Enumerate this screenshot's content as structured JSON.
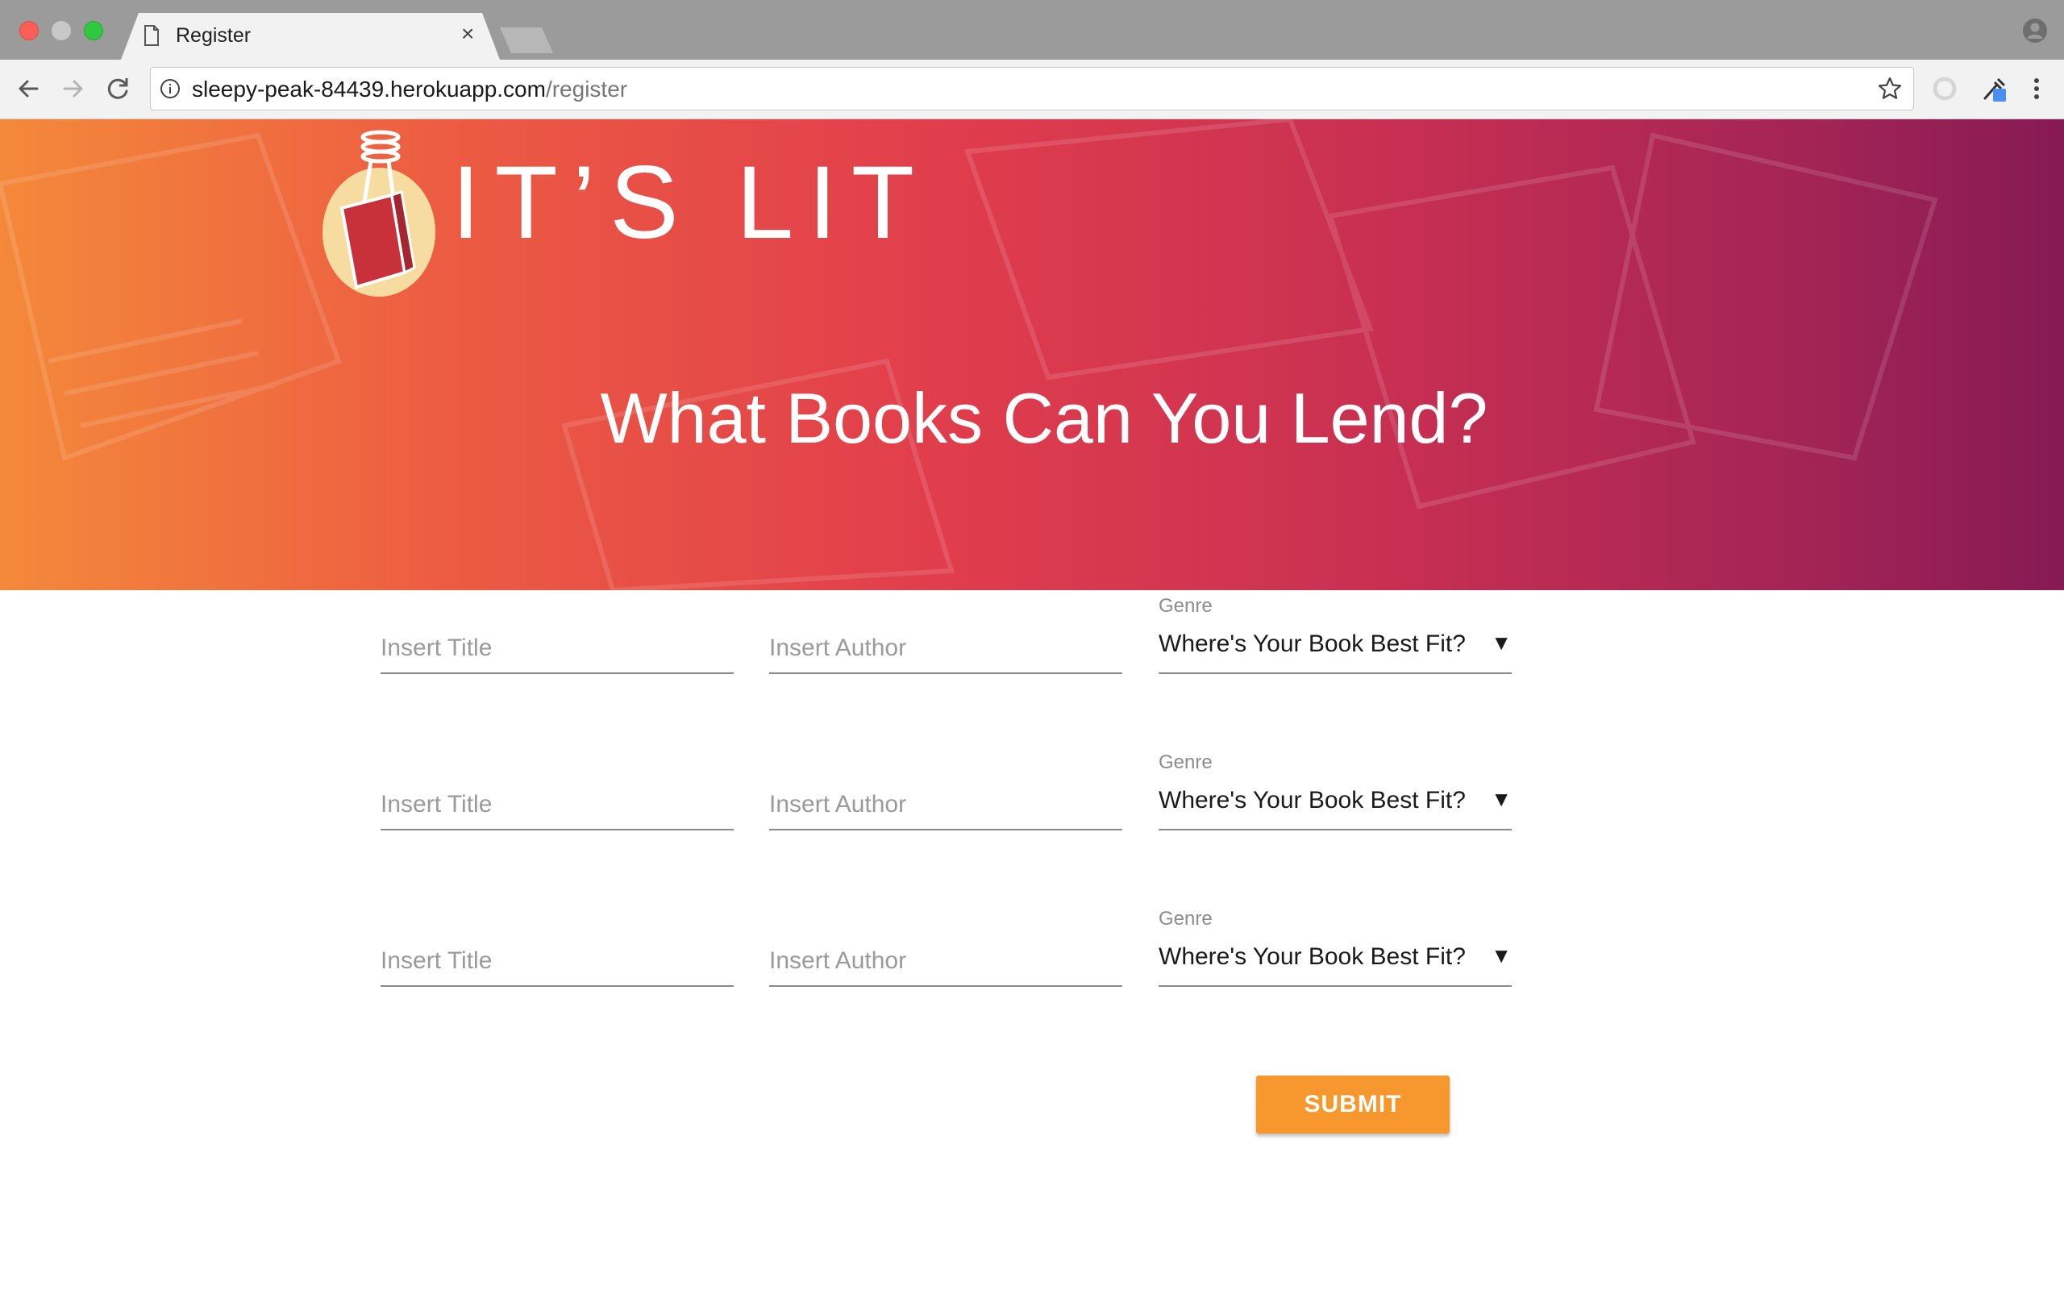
{
  "browser": {
    "tab_title": "Register",
    "tab_close": "×",
    "url_host": "sleepy-peak-84439.herokuapp.com",
    "url_path": "/register"
  },
  "hero": {
    "logo_text": "IT’S LIT",
    "heading": "What Books Can You Lend?"
  },
  "form": {
    "rows": [
      {
        "title_placeholder": "Insert Title",
        "author_placeholder": "Insert Author",
        "genre_label": "Genre",
        "genre_value": "Where's Your Book Best Fit?"
      },
      {
        "title_placeholder": "Insert Title",
        "author_placeholder": "Insert Author",
        "genre_label": "Genre",
        "genre_value": "Where's Your Book Best Fit?"
      },
      {
        "title_placeholder": "Insert Title",
        "author_placeholder": "Insert Author",
        "genre_label": "Genre",
        "genre_value": "Where's Your Book Best Fit?"
      }
    ],
    "dropdown_arrow": "▼",
    "submit_label": "SUBMIT"
  },
  "colors": {
    "hero_gradient_start": "#f4893a",
    "hero_gradient_end": "#861a54",
    "submit_button": "#f7982e"
  },
  "icons": [
    "page-icon",
    "close-icon",
    "profile-icon",
    "back-icon",
    "forward-icon",
    "reload-icon",
    "info-icon",
    "star-icon",
    "extension-icon",
    "eyedropper-icon",
    "menu-icon",
    "lightbulb-book-logo"
  ]
}
